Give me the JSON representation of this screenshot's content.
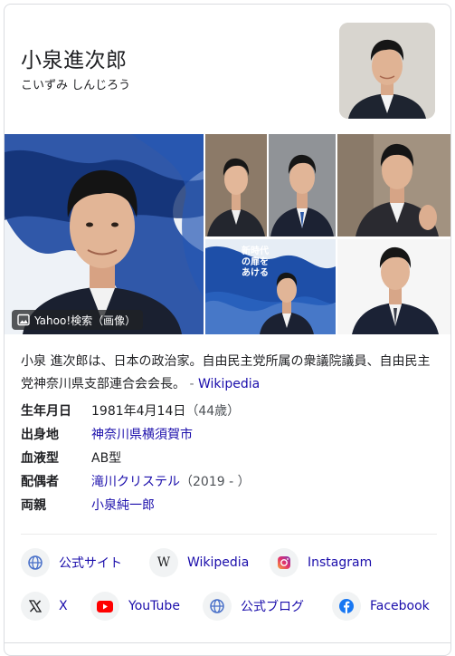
{
  "header": {
    "title": "小泉進次郎",
    "subtitle": "こいずみ しんじろう"
  },
  "gallery": {
    "overlay_label": "Yahoo!検索（画像）",
    "poster_text": "新時代の扉をあける"
  },
  "description": {
    "text": "小泉 進次郎は、日本の政治家。自由民主党所属の衆議院議員、自由民主党神奈川県支部連合会会長。",
    "source_separator": "-",
    "source": "Wikipedia"
  },
  "facts": [
    {
      "key": "生年月日",
      "value": "1981年4月14日",
      "extra": "（44歳）"
    },
    {
      "key": "出身地",
      "value": "神奈川県横須賀市",
      "extra": ""
    },
    {
      "key": "血液型",
      "value": "AB型",
      "extra": ""
    },
    {
      "key": "配偶者",
      "value": "滝川クリステル",
      "extra": "（2019 - ）"
    },
    {
      "key": "両親",
      "value": "小泉純一郎",
      "extra": ""
    }
  ],
  "links": [
    {
      "label": "公式サイト",
      "icon": "globe-icon"
    },
    {
      "label": "Wikipedia",
      "icon": "wikipedia-icon"
    },
    {
      "label": "Instagram",
      "icon": "instagram-icon"
    },
    {
      "label": "X",
      "icon": "x-icon"
    },
    {
      "label": "YouTube",
      "icon": "youtube-icon"
    },
    {
      "label": "公式ブログ",
      "icon": "globe-icon"
    },
    {
      "label": "Facebook",
      "icon": "facebook-icon"
    }
  ],
  "colors": {
    "link": "#1a0dab",
    "text": "#202124",
    "secondary": "#4d5156",
    "border": "#dadce0",
    "chip_bg": "#f1f3f4",
    "youtube": "#ff0000",
    "facebook": "#1877f2",
    "globe": "#4a71c9"
  }
}
